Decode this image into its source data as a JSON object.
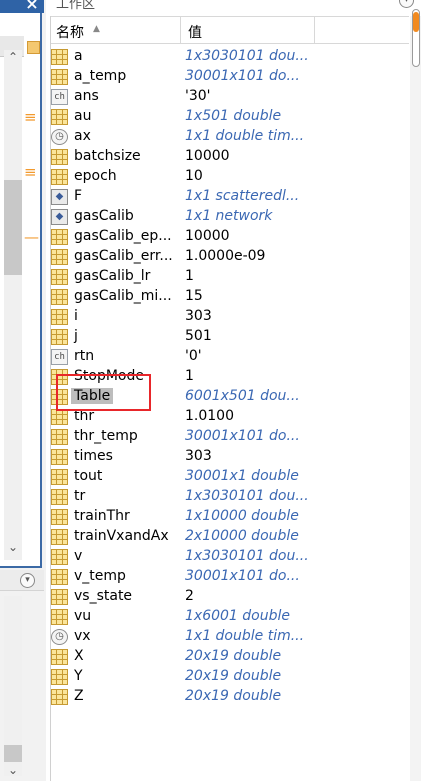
{
  "left_panel": {
    "close_glyph": "×",
    "up_arrow": "⌃",
    "down_arrow": "⌄",
    "menu_glyph": "▾",
    "orange_marks": [
      "≡",
      "≡",
      "—"
    ]
  },
  "workspace": {
    "title": "工作区",
    "menu_glyph": "▾",
    "header": {
      "name_label": "名称",
      "sort_glyph": "▲",
      "value_label": "值"
    },
    "rows": [
      {
        "name": "a",
        "value": "1x3030101 dou...",
        "icon": "matrix",
        "style": "italic"
      },
      {
        "name": "a_temp",
        "value": "30001x101 do...",
        "icon": "matrix",
        "style": "italic"
      },
      {
        "name": "ans",
        "value": "'30'",
        "icon": "char",
        "style": "plain"
      },
      {
        "name": "au",
        "value": "1x501 double",
        "icon": "matrix",
        "style": "italic"
      },
      {
        "name": "ax",
        "value": "1x1 double tim...",
        "icon": "clock",
        "style": "italic"
      },
      {
        "name": "batchsize",
        "value": "10000",
        "icon": "matrix",
        "style": "plain"
      },
      {
        "name": "epoch",
        "value": "10",
        "icon": "matrix",
        "style": "plain"
      },
      {
        "name": "F",
        "value": "1x1 scatteredl...",
        "icon": "obj",
        "style": "italic"
      },
      {
        "name": "gasCalib",
        "value": "1x1 network",
        "icon": "obj",
        "style": "italic"
      },
      {
        "name": "gasCalib_ep...",
        "value": "10000",
        "icon": "matrix",
        "style": "plain"
      },
      {
        "name": "gasCalib_err...",
        "value": "1.0000e-09",
        "icon": "matrix",
        "style": "plain"
      },
      {
        "name": "gasCalib_lr",
        "value": "1",
        "icon": "matrix",
        "style": "plain"
      },
      {
        "name": "gasCalib_mi...",
        "value": "15",
        "icon": "matrix",
        "style": "plain"
      },
      {
        "name": "i",
        "value": "303",
        "icon": "matrix",
        "style": "plain"
      },
      {
        "name": "j",
        "value": "501",
        "icon": "matrix",
        "style": "plain"
      },
      {
        "name": "rtn",
        "value": "'0'",
        "icon": "char",
        "style": "plain"
      },
      {
        "name": "StopMode",
        "value": "1",
        "icon": "matrix",
        "style": "plain"
      },
      {
        "name": "Table",
        "value": "6001x501 dou...",
        "icon": "matrix",
        "style": "italic",
        "selected": true
      },
      {
        "name": "thr",
        "value": "1.0100",
        "icon": "matrix",
        "style": "plain"
      },
      {
        "name": "thr_temp",
        "value": "30001x101 do...",
        "icon": "matrix",
        "style": "italic"
      },
      {
        "name": "times",
        "value": "303",
        "icon": "matrix",
        "style": "plain"
      },
      {
        "name": "tout",
        "value": "30001x1 double",
        "icon": "matrix",
        "style": "italic"
      },
      {
        "name": "tr",
        "value": "1x3030101 dou...",
        "icon": "matrix",
        "style": "italic"
      },
      {
        "name": "trainThr",
        "value": "1x10000 double",
        "icon": "matrix",
        "style": "italic"
      },
      {
        "name": "trainVxandAx",
        "value": "2x10000 double",
        "icon": "matrix",
        "style": "italic"
      },
      {
        "name": "v",
        "value": "1x3030101 dou...",
        "icon": "matrix",
        "style": "italic"
      },
      {
        "name": "v_temp",
        "value": "30001x101 do...",
        "icon": "matrix",
        "style": "italic"
      },
      {
        "name": "vs_state",
        "value": "2",
        "icon": "matrix",
        "style": "plain"
      },
      {
        "name": "vu",
        "value": "1x6001 double",
        "icon": "matrix",
        "style": "italic"
      },
      {
        "name": "vx",
        "value": "1x1 double tim...",
        "icon": "clock",
        "style": "italic"
      },
      {
        "name": "X",
        "value": "20x19 double",
        "icon": "matrix",
        "style": "italic"
      },
      {
        "name": "Y",
        "value": "20x19 double",
        "icon": "matrix",
        "style": "italic"
      },
      {
        "name": "Z",
        "value": "20x19 double",
        "icon": "matrix",
        "style": "italic"
      }
    ]
  },
  "colors": {
    "italic_value": "#3b68b3",
    "highlight_box": "#e8262a",
    "title_bar": "#2f63a6",
    "accent_orange": "#f28a1f"
  }
}
